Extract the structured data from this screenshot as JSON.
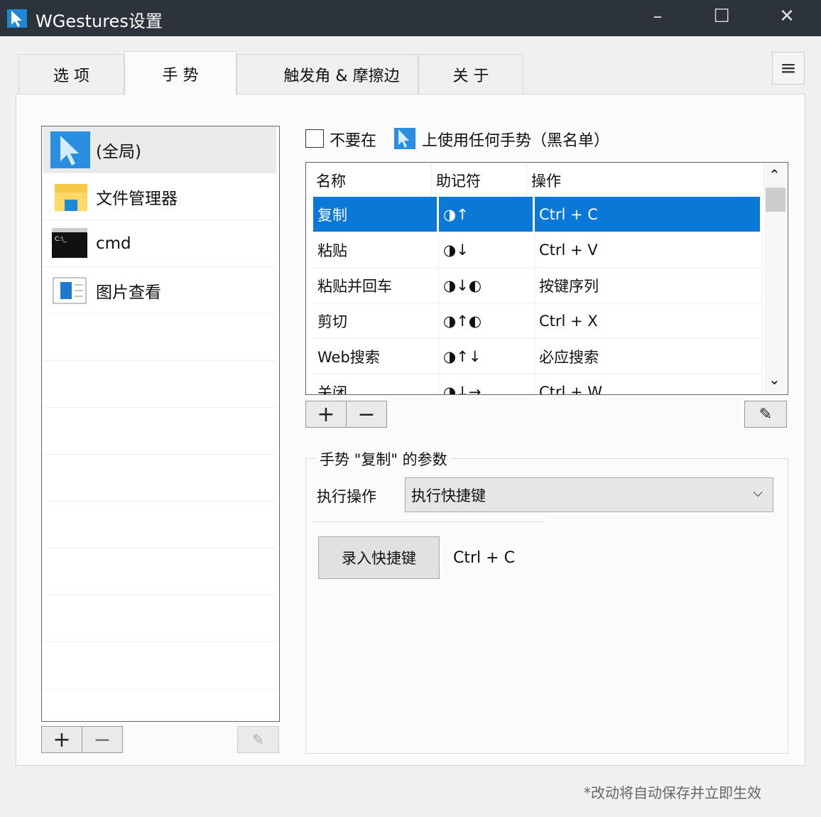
{
  "window": {
    "title": "WGestures设置",
    "minimize": "–",
    "maximize": "☐",
    "close": "✕"
  },
  "tabs": [
    {
      "label": "选 项"
    },
    {
      "label": "手 势"
    },
    {
      "label": "触发角 & 摩擦边"
    },
    {
      "label": "关 于"
    }
  ],
  "menu_icon": "hamburger-icon",
  "apps": [
    {
      "label": "(全局)",
      "icon": "cursor-icon"
    },
    {
      "label": "文件管理器",
      "icon": "folder-icon"
    },
    {
      "label": "cmd",
      "icon": "terminal-icon"
    },
    {
      "label": "图片查看",
      "icon": "image-viewer-icon"
    }
  ],
  "app_buttons": {
    "add": "+",
    "remove": "−"
  },
  "blacklist": {
    "label_before": "不要在",
    "label_after": "上使用任何手势（黑名单）",
    "checked": false
  },
  "table": {
    "headers": [
      "名称",
      "助记符",
      "操作"
    ],
    "rows": [
      {
        "name": "复制",
        "mnemonic": "◑↑",
        "action": "Ctrl + C",
        "selected": true
      },
      {
        "name": "粘贴",
        "mnemonic": "◑↓",
        "action": "Ctrl + V"
      },
      {
        "name": "粘贴并回车",
        "mnemonic": "◑↓◐",
        "action": "按键序列"
      },
      {
        "name": "剪切",
        "mnemonic": "◑↑◐",
        "action": "Ctrl + X"
      },
      {
        "name": "Web搜索",
        "mnemonic": "◑↑↓",
        "action": "必应搜索"
      },
      {
        "name": "关闭",
        "mnemonic": "◑↓→",
        "action": "Ctrl + W"
      }
    ],
    "scroll_up": "⌃",
    "scroll_down": "⌄"
  },
  "gesture_buttons": {
    "add": "+",
    "remove": "−"
  },
  "params": {
    "title": "手势 \"复制\" 的参数",
    "action_label": "执行操作",
    "action_value": "执行快捷键",
    "record_button": "录入快捷键",
    "hotkey": "Ctrl + C"
  },
  "footer": "*改动将自动保存并立即生效"
}
